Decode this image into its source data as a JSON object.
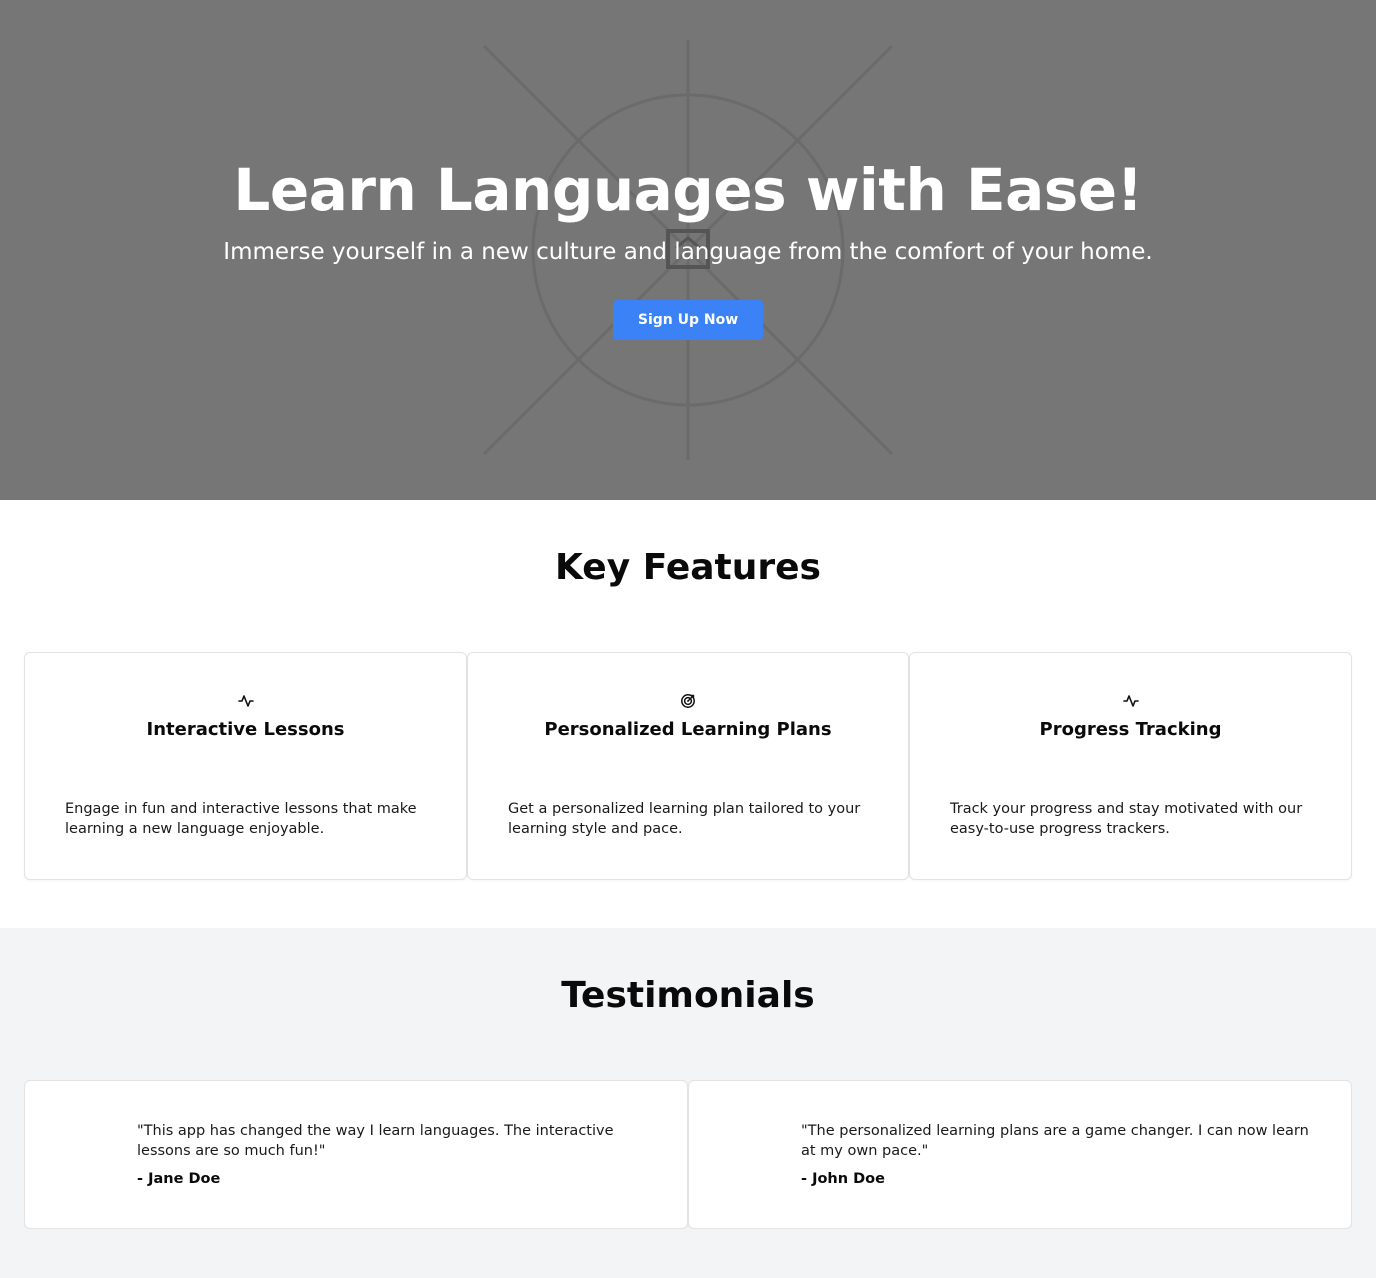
{
  "hero": {
    "title": "Learn Languages with Ease!",
    "subtitle": "Immerse yourself in a new culture and language from the comfort of your home.",
    "cta_label": "Sign Up Now",
    "background_color": "#767676",
    "cta_color": "#3b82f6",
    "image_icon": "broken-image-icon"
  },
  "features": {
    "title": "Key Features",
    "items": [
      {
        "icon": "activity-icon",
        "title": "Interactive Lessons",
        "description": "Engage in fun and interactive lessons that make learning a new language enjoyable."
      },
      {
        "icon": "target-icon",
        "title": "Personalized Learning Plans",
        "description": "Get a personalized learning plan tailored to your learning style and pace."
      },
      {
        "icon": "activity-icon",
        "title": "Progress Tracking",
        "description": "Track your progress and stay motivated with our easy-to-use progress trackers."
      }
    ]
  },
  "testimonials": {
    "title": "Testimonials",
    "background_color": "#f3f4f6",
    "items": [
      {
        "quote": "\"This app has changed the way I learn languages. The interactive lessons are so much fun!\"",
        "author": "- Jane Doe"
      },
      {
        "quote": "\"The personalized learning plans are a game changer. I can now learn at my own pace.\"",
        "author": "- John Doe"
      }
    ]
  }
}
